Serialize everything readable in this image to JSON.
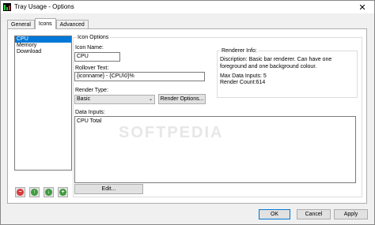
{
  "window": {
    "title": "Tray Usage - Options",
    "close_glyph": "✕"
  },
  "tabs": [
    {
      "label": "General"
    },
    {
      "label": "Icons"
    },
    {
      "label": "Advanced"
    }
  ],
  "sensors": [
    {
      "label": "CPU",
      "selected": true
    },
    {
      "label": "Memory",
      "selected": false
    },
    {
      "label": "Download",
      "selected": false
    }
  ],
  "list_buttons": [
    {
      "icon": "remove-icon",
      "glyph": "−",
      "color": "#d83b3b"
    },
    {
      "icon": "move-up-icon",
      "glyph": "↑",
      "color": "#3e9b3e"
    },
    {
      "icon": "move-down-icon",
      "glyph": "↓",
      "color": "#3e9b3e"
    },
    {
      "icon": "add-icon",
      "glyph": "+",
      "color": "#3e9b3e"
    }
  ],
  "icon_options": {
    "group_title": "Icon Options",
    "icon_name_label": "Icon Name:",
    "icon_name_value": "CPU",
    "rollover_label": "Rollover Text:",
    "rollover_value": "{iconname} - {CPU\\0}%",
    "render_type_label": "Render Type:",
    "render_type_value": "Basic",
    "render_options_button": "Render Options...",
    "data_inputs_label": "Data Inputs:",
    "data_inputs_value": "CPU Total",
    "edit_button": "Edit..."
  },
  "renderer_info": {
    "group_title": "Renderer Info:",
    "description": "Discription: Basic bar renderer. Can have one foreground and one background colour.",
    "max_inputs": "Max Data Inputs: 5",
    "render_count": "Render Count:614"
  },
  "footer": {
    "ok": "OK",
    "cancel": "Cancel",
    "apply": "Apply"
  },
  "watermark": "SOFTPEDIA",
  "colors": {
    "selection": "#0078d7",
    "default_button_border": "#0078d7"
  }
}
